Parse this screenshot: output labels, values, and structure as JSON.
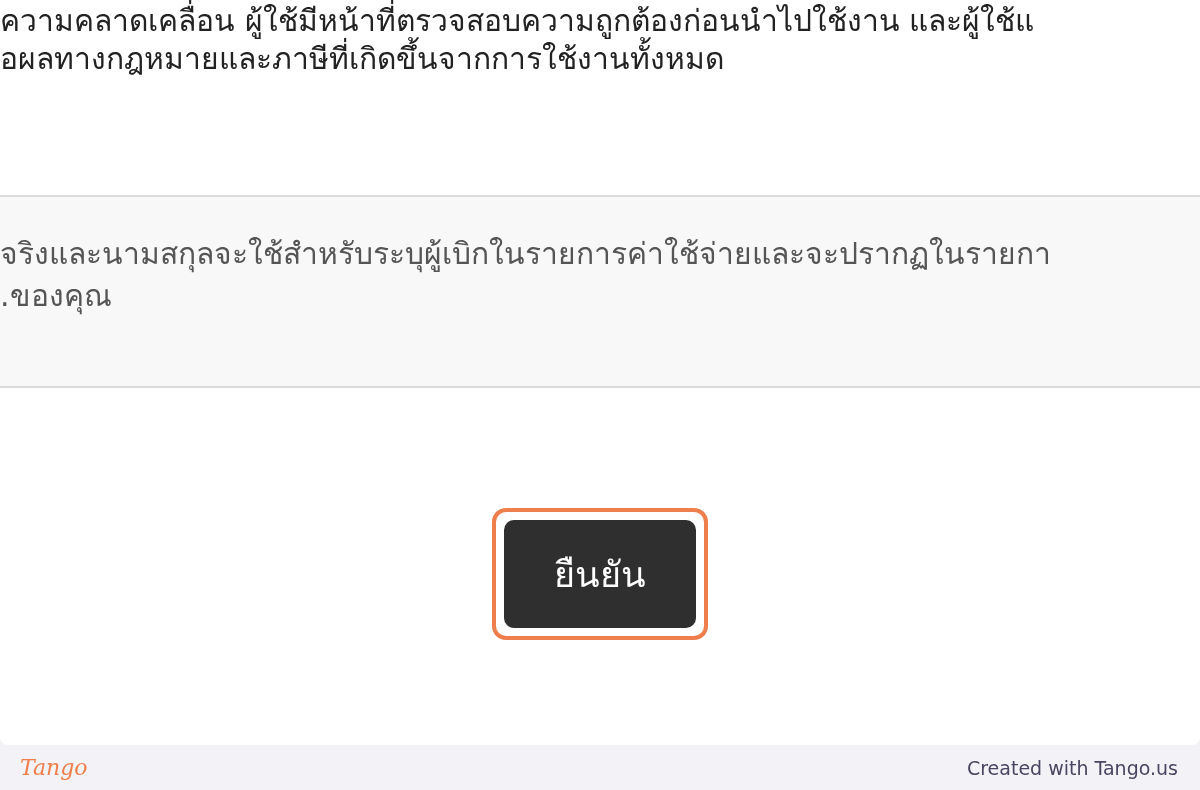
{
  "disclaimer": {
    "lines": [
      "ความคลาดเคลื่อน ผู้ใช้มีหน้าที่ตรวจสอบความถูกต้องก่อนนำไปใช้งาน และผู้ใช้แ",
      "อผลทางกฎหมายและภาษีที่เกิดขึ้นจากการใช้งานทั้งหมด"
    ]
  },
  "note": {
    "lines": [
      "จริงและนามสกุลจะใช้สำหรับระบุผู้เบิกในรายการค่าใช้จ่ายและจะปรากฏในรายกา",
      ".ของคุณ"
    ]
  },
  "confirm_button": {
    "label": "ยืนยัน",
    "highlighted": true
  },
  "footer": {
    "logo": "Tango",
    "credit": "Created with Tango.us"
  }
}
